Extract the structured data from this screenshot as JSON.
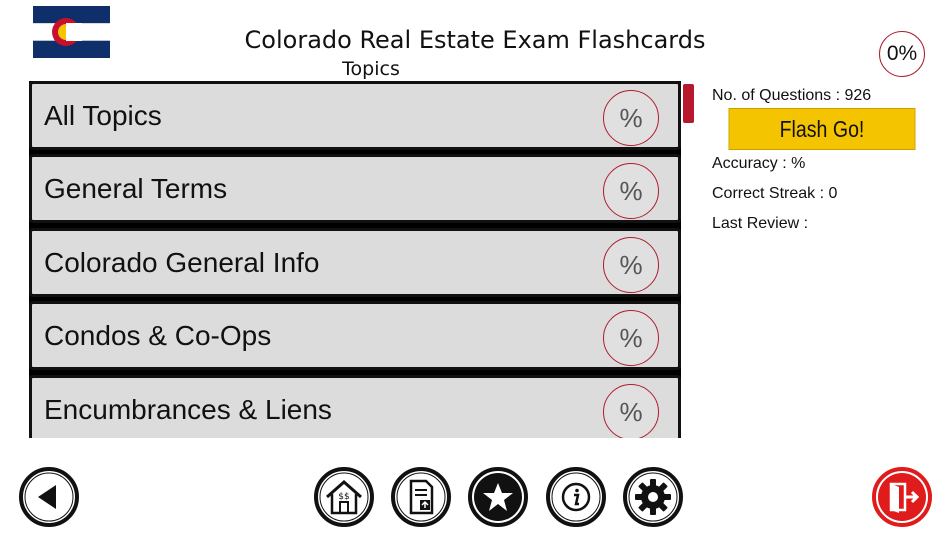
{
  "header": {
    "title": "Colorado Real Estate Exam Flashcards",
    "subtitle": "Topics",
    "overall_progress": "0%"
  },
  "topics": [
    {
      "label": "All Topics",
      "percent": "%"
    },
    {
      "label": "General Terms",
      "percent": "%"
    },
    {
      "label": "Colorado General Info",
      "percent": "%"
    },
    {
      "label": "Condos & Co-Ops",
      "percent": "%"
    },
    {
      "label": "Encumbrances & Liens",
      "percent": "%"
    }
  ],
  "stats": {
    "questions": "No. of Questions : 926",
    "flash_button": "Flash Go!",
    "accuracy": "Accuracy : %",
    "streak": "Correct Streak : 0",
    "last_review": "Last Review :"
  },
  "toolbar": {
    "home_dollar": "$$",
    "icons": [
      "back-arrow-icon",
      "home-icon",
      "document-upload-icon",
      "star-icon",
      "info-icon",
      "gear-icon",
      "exit-door-icon"
    ]
  },
  "colors": {
    "accent_red": "#b01c2e",
    "flash_yellow": "#f5c400",
    "row_gray": "#dcdcdc",
    "flag_blue": "#0f2f6b",
    "flag_gold": "#f5c400"
  }
}
